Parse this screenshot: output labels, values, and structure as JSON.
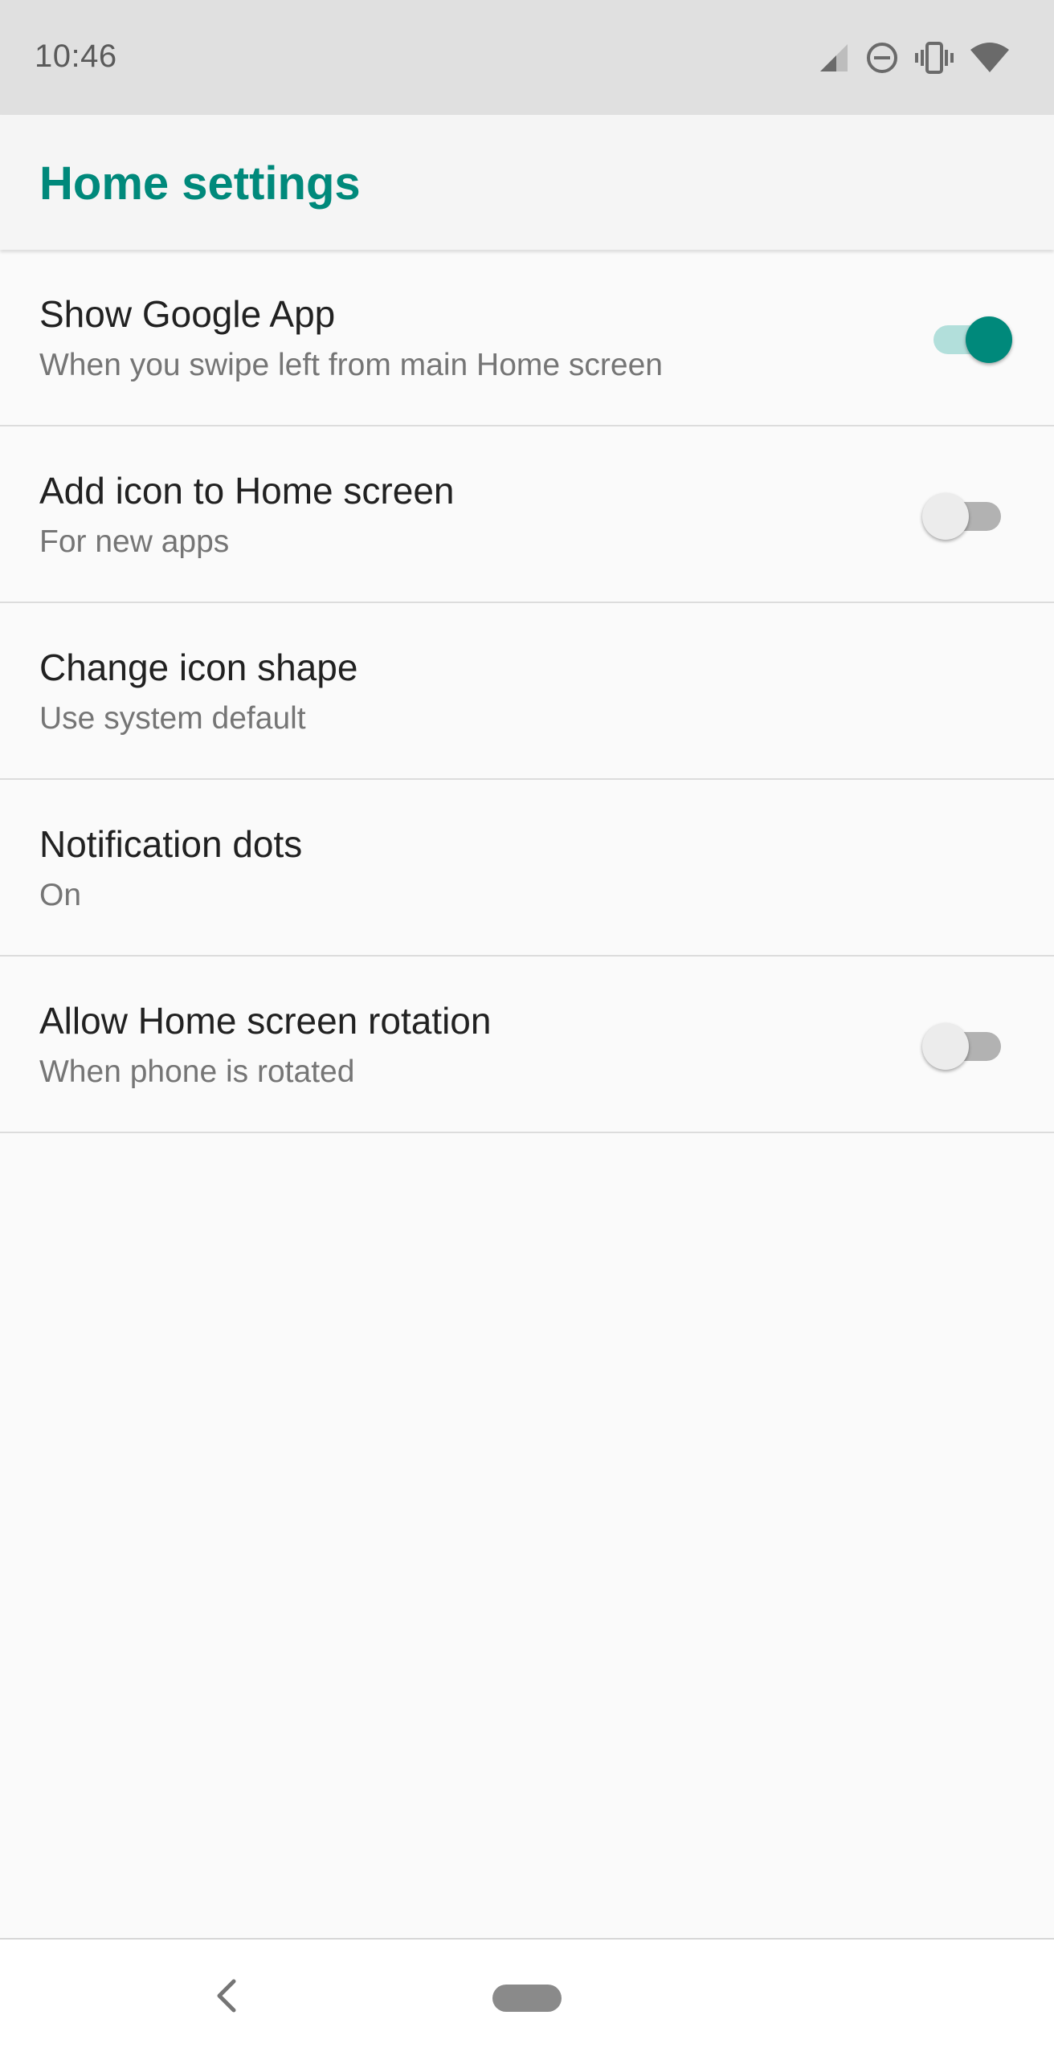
{
  "status_bar": {
    "time": "10:46",
    "icons": [
      "signal-icon",
      "do-not-disturb-icon",
      "vibrate-icon",
      "wifi-icon"
    ]
  },
  "app_bar": {
    "title": "Home settings"
  },
  "settings": [
    {
      "title": "Show Google App",
      "summary": "When you swipe left from main Home screen",
      "control": "switch",
      "checked": true
    },
    {
      "title": "Add icon to Home screen",
      "summary": "For new apps",
      "control": "switch",
      "checked": false
    },
    {
      "title": "Change icon shape",
      "summary": "Use system default",
      "control": "none"
    },
    {
      "title": "Notification dots",
      "summary": "On",
      "control": "none"
    },
    {
      "title": "Allow Home screen rotation",
      "summary": "When phone is rotated",
      "control": "switch",
      "checked": false
    }
  ],
  "nav_bar": {
    "icons": [
      "back-icon",
      "home-pill-icon"
    ]
  },
  "colors": {
    "accent": "#00897b",
    "accent_track": "#b2dfdb",
    "status_bar": "#e0e0e0",
    "app_bar": "#f5f5f5",
    "background": "#fafafa",
    "title_text": "#212121",
    "summary_text": "#757575"
  }
}
